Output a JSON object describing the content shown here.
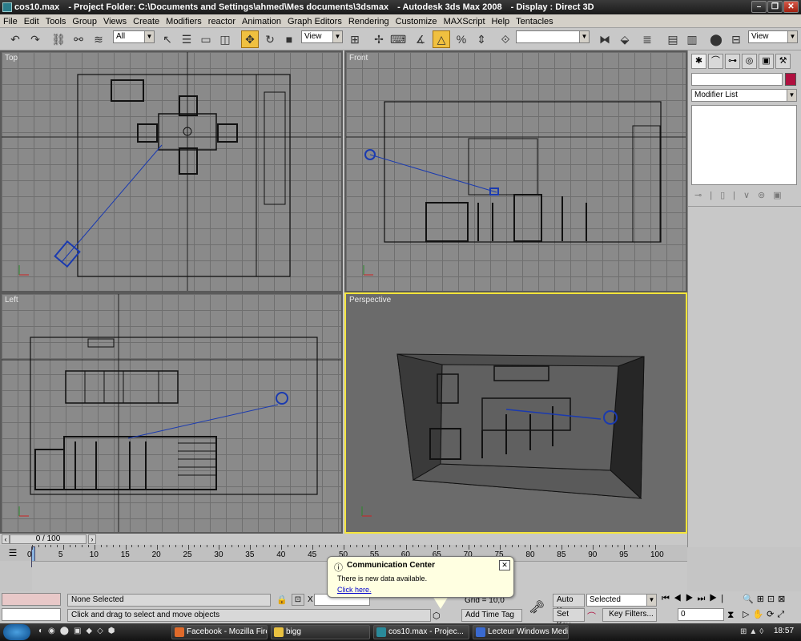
{
  "window": {
    "file": "cos10.max",
    "project": "- Project Folder: C:\\Documents and Settings\\ahmed\\Mes documents\\3dsmax",
    "app": "- Autodesk 3ds Max 2008",
    "display": "- Display : Direct 3D"
  },
  "menu": [
    "File",
    "Edit",
    "Tools",
    "Group",
    "Views",
    "Create",
    "Modifiers",
    "reactor",
    "Animation",
    "Graph Editors",
    "Rendering",
    "Customize",
    "MAXScript",
    "Help",
    "Tentacles"
  ],
  "toolbar": {
    "selection_filter": "All",
    "ref_coord": "View",
    "named_sel": "",
    "ref_coord2": "View"
  },
  "viewports": {
    "top": "Top",
    "front": "Front",
    "left": "Left",
    "perspective": "Perspective"
  },
  "command_panel": {
    "name_field": "",
    "modifier_list": "Modifier List",
    "accent": "#b01040"
  },
  "time": {
    "frame": "0 / 100",
    "ticks": [
      "0",
      "5",
      "10",
      "15",
      "20",
      "25",
      "30",
      "35",
      "40",
      "45",
      "50",
      "55",
      "60",
      "65",
      "70",
      "75",
      "80",
      "85",
      "90",
      "95",
      "100"
    ]
  },
  "status": {
    "selection": "None Selected",
    "prompt": "Click and drag to select and move objects",
    "x_label": "X",
    "grid": "Grid = 10,0",
    "add_time_tag": "Add Time Tag",
    "auto_key": "Auto Key",
    "set_key": "Set Key",
    "selected": "Selected",
    "key_filters": "Key Filters...",
    "frame_field": "0"
  },
  "notification": {
    "title": "Communication Center",
    "message": "There is new data available.",
    "link": "Click here."
  },
  "taskbar": {
    "items": [
      "Facebook - Mozilla Fire...",
      "bigg",
      "cos10.max   - Projec...",
      "Lecteur Windows Media"
    ],
    "clock": "18:57"
  }
}
